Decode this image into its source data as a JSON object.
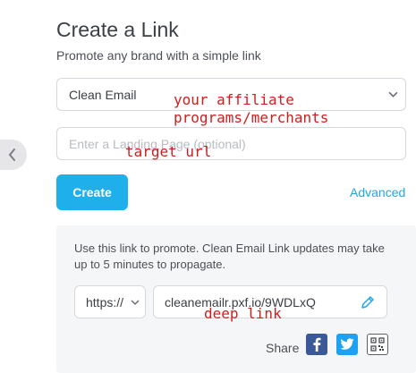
{
  "header": {
    "title": "Create a Link",
    "subtitle": "Promote any brand with a simple link"
  },
  "form": {
    "merchant_selected": "Clean Email",
    "landing_placeholder": "Enter a Landing Page (optional)",
    "create_label": "Create",
    "advanced_label": "Advanced"
  },
  "result": {
    "info_text": "Use this link to promote. Clean Email Link updates may take up to 5 minutes to propagate.",
    "protocol_selected": "https://",
    "link_value": "cleanemailr.pxf.io/9WDLxQ",
    "share_label": "Share"
  },
  "annotations": {
    "affiliate": [
      "your affiliate",
      "programs/merchants"
    ],
    "target": "target url",
    "deep": "deep link"
  },
  "icons": {
    "back": "chevron-left-icon",
    "select_chevron": "chevron-down-icon",
    "edit": "pencil-icon",
    "facebook": "facebook-icon",
    "twitter": "twitter-icon",
    "qr": "qr-code-icon"
  },
  "colors": {
    "accent": "#1fb0ec",
    "link": "#1fa8e4",
    "facebook": "#3b5998",
    "twitter": "#1da1f2",
    "annotation": "#d21d1d",
    "panel_bg": "#f5f6f7"
  }
}
